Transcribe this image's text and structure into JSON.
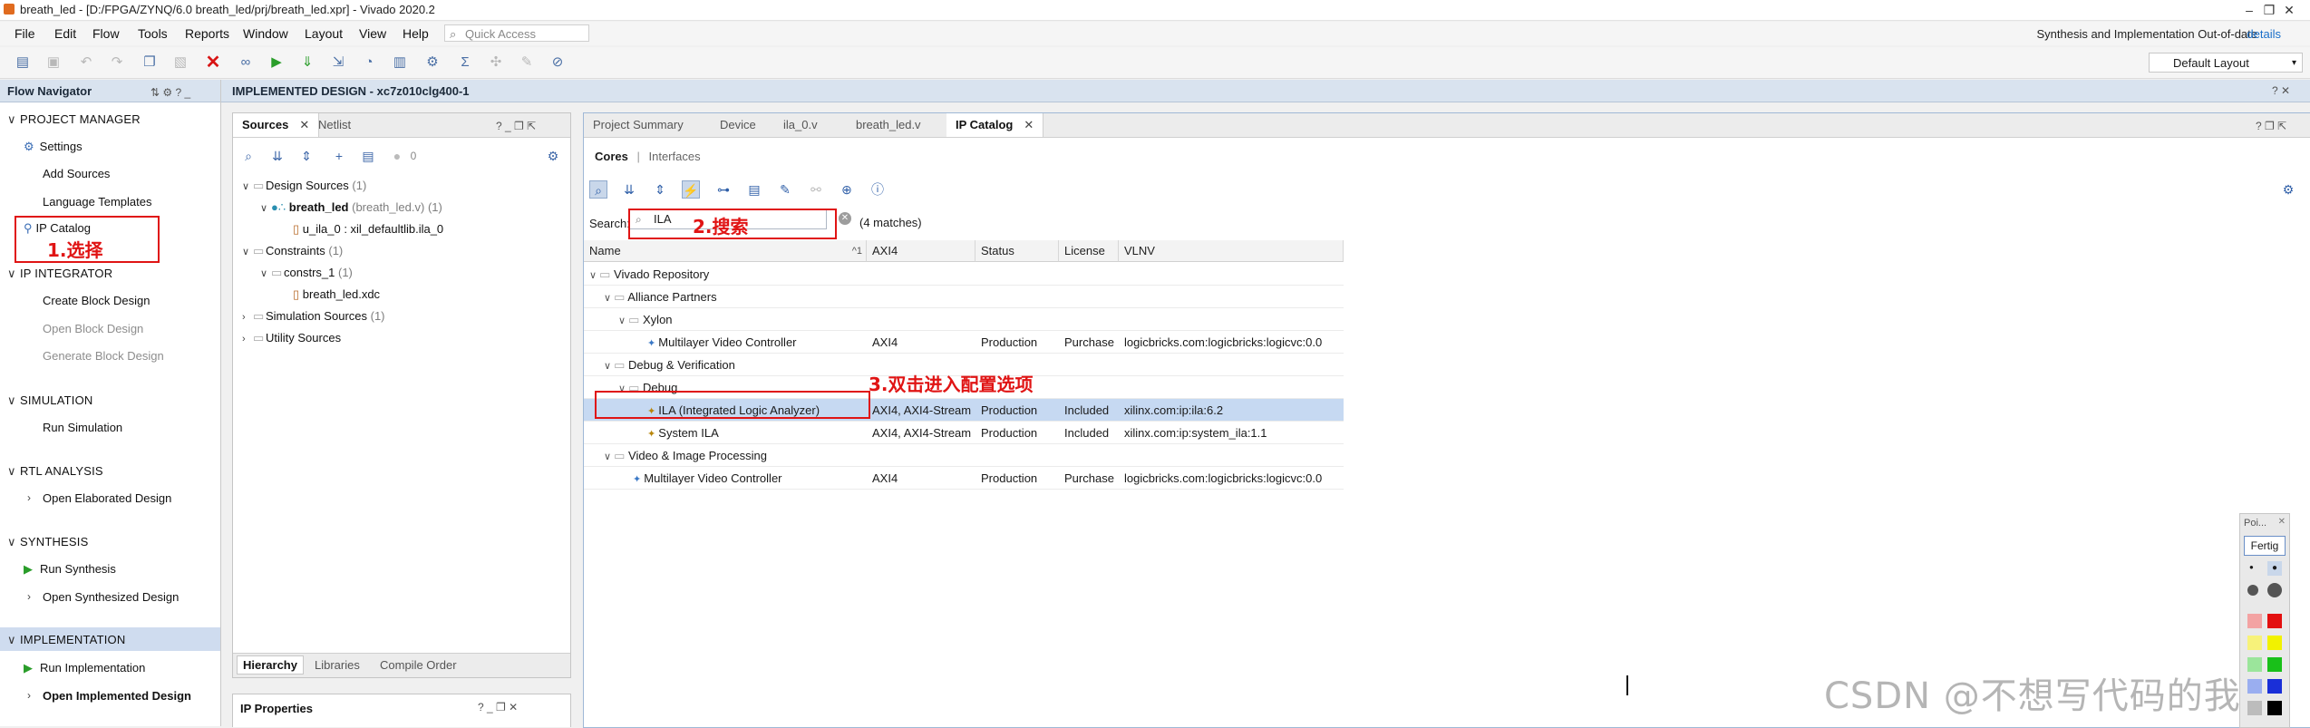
{
  "window": {
    "title": "breath_led - [D:/FPGA/ZYNQ/6.0 breath_led/prj/breath_led.xpr] - Vivado 2020.2",
    "controls": [
      "–",
      "❐",
      "✕"
    ]
  },
  "menubar": {
    "items": [
      "File",
      "Edit",
      "Flow",
      "Tools",
      "Reports",
      "Window",
      "Layout",
      "View",
      "Help"
    ],
    "quick_access_placeholder": "Quick Access",
    "status_text": "Synthesis and Implementation Out-of-date",
    "details_link": "details"
  },
  "toolbar": {
    "layout_select": "Default Layout"
  },
  "flow_navigator": {
    "title": "Flow Navigator",
    "sections": [
      {
        "label": "PROJECT MANAGER",
        "items": [
          "Settings",
          "Add Sources",
          "Language Templates",
          "IP Catalog"
        ]
      },
      {
        "label": "IP INTEGRATOR",
        "items": [
          "Create Block Design",
          "Open Block Design",
          "Generate Block Design"
        ]
      },
      {
        "label": "SIMULATION",
        "items": [
          "Run Simulation"
        ]
      },
      {
        "label": "RTL ANALYSIS",
        "items": [
          "Open Elaborated Design"
        ]
      },
      {
        "label": "SYNTHESIS",
        "items": [
          "Run Synthesis",
          "Open Synthesized Design"
        ]
      },
      {
        "label": "IMPLEMENTATION",
        "items": [
          "Run Implementation",
          "Open Implemented Design"
        ]
      }
    ]
  },
  "banner": {
    "title": "IMPLEMENTED DESIGN - xc7z010clg400-1"
  },
  "sources_panel": {
    "tabs": [
      "Sources",
      "Netlist"
    ],
    "badge_count": "0",
    "tree": {
      "design_sources": "Design Sources",
      "design_sources_count": "(1)",
      "top_module": "breath_led",
      "top_module_file": "(breath_led.v) (1)",
      "ila_instance": "u_ila_0 : xil_defaultlib.ila_0",
      "constraints": "Constraints",
      "constraints_count": "(1)",
      "constrs": "constrs_1",
      "constrs_count": "(1)",
      "xdc": "breath_led.xdc",
      "sim_sources": "Simulation Sources",
      "sim_sources_count": "(1)",
      "utility_sources": "Utility Sources"
    },
    "bottom_tabs": [
      "Hierarchy",
      "Libraries",
      "Compile Order"
    ]
  },
  "ip_properties": {
    "title": "IP Properties"
  },
  "catalog": {
    "tabs": [
      "Project Summary",
      "Device",
      "ila_0.v",
      "breath_led.v",
      "IP Catalog"
    ],
    "subtabs": [
      "Cores",
      "Interfaces"
    ],
    "search_label": "Search:",
    "search_value": "ILA",
    "matches": "(4 matches)",
    "columns": [
      "Name",
      "AXI4",
      "Status",
      "License",
      "VLNV"
    ],
    "sort_marker": "^1",
    "rows": [
      {
        "name": "Vivado Repository",
        "axi4": "",
        "status": "",
        "license": "",
        "vlnv": "",
        "level": 0,
        "kind": "folder"
      },
      {
        "name": "Alliance Partners",
        "axi4": "",
        "status": "",
        "license": "",
        "vlnv": "",
        "level": 1,
        "kind": "folder"
      },
      {
        "name": "Xylon",
        "axi4": "",
        "status": "",
        "license": "",
        "vlnv": "",
        "level": 2,
        "kind": "folder"
      },
      {
        "name": "Multilayer Video Controller",
        "axi4": "AXI4",
        "status": "Production",
        "license": "Purchase",
        "vlnv": "logicbricks.com:logicbricks:logicvc:0.0",
        "level": 3,
        "kind": "ip"
      },
      {
        "name": "Debug & Verification",
        "axi4": "",
        "status": "",
        "license": "",
        "vlnv": "",
        "level": 1,
        "kind": "folder"
      },
      {
        "name": "Debug",
        "axi4": "",
        "status": "",
        "license": "",
        "vlnv": "",
        "level": 2,
        "kind": "folder"
      },
      {
        "name": "ILA (Integrated Logic Analyzer)",
        "axi4": "AXI4, AXI4-Stream",
        "status": "Production",
        "license": "Included",
        "vlnv": "xilinx.com:ip:ila:6.2",
        "level": 3,
        "kind": "ip-y",
        "selected": true
      },
      {
        "name": "System ILA",
        "axi4": "AXI4, AXI4-Stream",
        "status": "Production",
        "license": "Included",
        "vlnv": "xilinx.com:ip:system_ila:1.1",
        "level": 3,
        "kind": "ip-y"
      },
      {
        "name": "Video & Image Processing",
        "axi4": "",
        "status": "",
        "license": "",
        "vlnv": "",
        "level": 1,
        "kind": "folder"
      },
      {
        "name": "Multilayer Video Controller",
        "axi4": "AXI4",
        "status": "Production",
        "license": "Purchase",
        "vlnv": "logicbricks.com:logicbricks:logicvc:0.0",
        "level": 2,
        "kind": "ip"
      }
    ]
  },
  "annotations": {
    "step1": "1.选择",
    "step2": "2.搜索",
    "step3": "3.双击进入配置选项",
    "color": "#e01414"
  },
  "palette": {
    "title": "Poi...",
    "done_button": "Fertig"
  },
  "watermark": "CSDN @不想写代码的我"
}
